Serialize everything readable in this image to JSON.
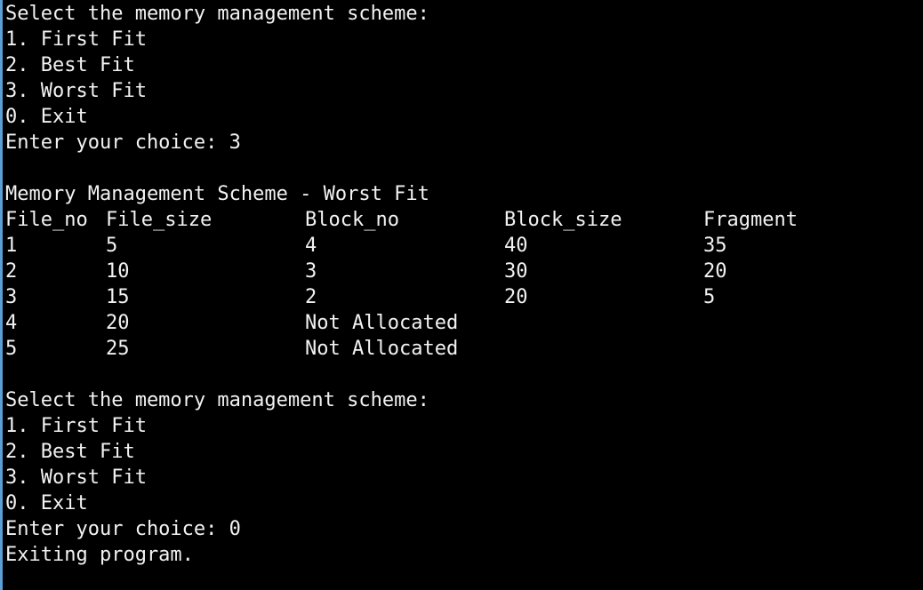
{
  "window": {
    "background": "#000000",
    "text_color": "#f2f2f2",
    "edge_color": "#5a9fd6"
  },
  "session": {
    "menu1": {
      "prompt": "Select the memory management scheme:",
      "options": [
        "1. First Fit",
        "2. Best Fit",
        "3. Worst Fit",
        "0. Exit"
      ],
      "input_line": "Enter your choice: 3"
    },
    "result": {
      "heading": "Memory Management Scheme - Worst Fit",
      "columns": [
        "File_no",
        "File_size",
        "Block_no",
        "Block_size",
        "Fragment"
      ],
      "rows": [
        [
          "1",
          "5",
          "4",
          "40",
          "35"
        ],
        [
          "2",
          "10",
          "3",
          "30",
          "20"
        ],
        [
          "3",
          "15",
          "2",
          "20",
          "5"
        ],
        [
          "4",
          "20",
          "Not Allocated",
          "",
          ""
        ],
        [
          "5",
          "25",
          "Not Allocated",
          "",
          ""
        ]
      ]
    },
    "menu2": {
      "prompt": "Select the memory management scheme:",
      "options": [
        "1. First Fit",
        "2. Best Fit",
        "3. Worst Fit",
        "0. Exit"
      ],
      "input_line": "Enter your choice: 0"
    },
    "exit_message": "Exiting program."
  }
}
